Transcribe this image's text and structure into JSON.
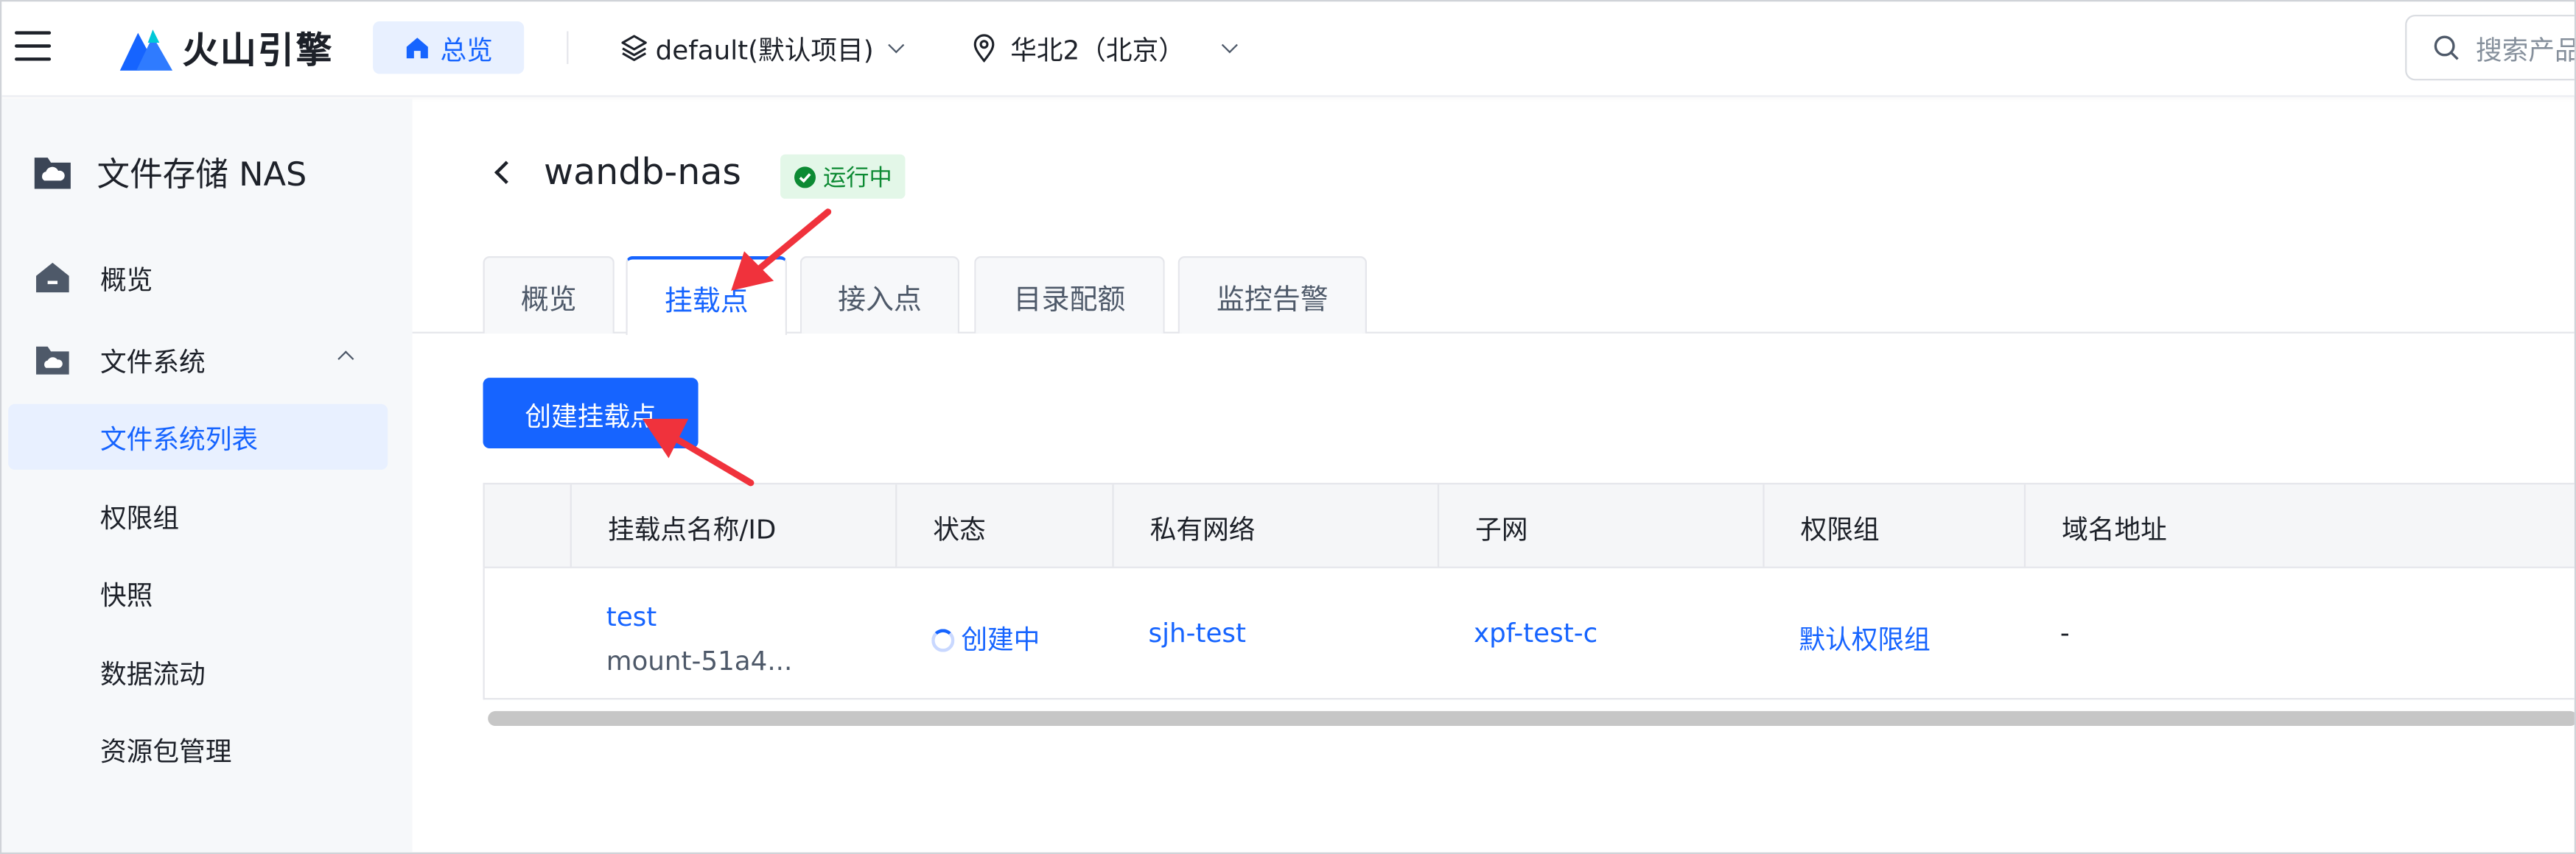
{
  "topbar": {
    "brand": "火山引擎",
    "home_label": "总览",
    "project": "default(默认项目)",
    "region": "华北2（北京）",
    "search_placeholder": "搜索产品"
  },
  "sidebar": {
    "title": "文件存储 NAS",
    "items": [
      {
        "label": "概览"
      },
      {
        "label": "文件系统"
      },
      {
        "label": "文件系统列表"
      },
      {
        "label": "权限组"
      },
      {
        "label": "快照"
      },
      {
        "label": "数据流动"
      },
      {
        "label": "资源包管理"
      }
    ]
  },
  "main": {
    "title": "wandb-nas",
    "status": "运行中",
    "tabs": [
      {
        "label": "概览"
      },
      {
        "label": "挂载点"
      },
      {
        "label": "接入点"
      },
      {
        "label": "目录配额"
      },
      {
        "label": "监控告警"
      }
    ],
    "create_button": "创建挂载点",
    "table": {
      "headers": [
        "挂载点名称/ID",
        "状态",
        "私有网络",
        "子网",
        "权限组",
        "域名地址"
      ],
      "rows": [
        {
          "name": "test",
          "id": "mount-51a4...",
          "status": "创建中",
          "vpc": "sjh-test",
          "subnet": "xpf-test-c",
          "permission_group": "默认权限组",
          "domain": "-"
        }
      ]
    }
  },
  "colors": {
    "accent": "#1664ff",
    "annotation_arrow": "#f0323c",
    "running_green": "#0c8a33"
  }
}
